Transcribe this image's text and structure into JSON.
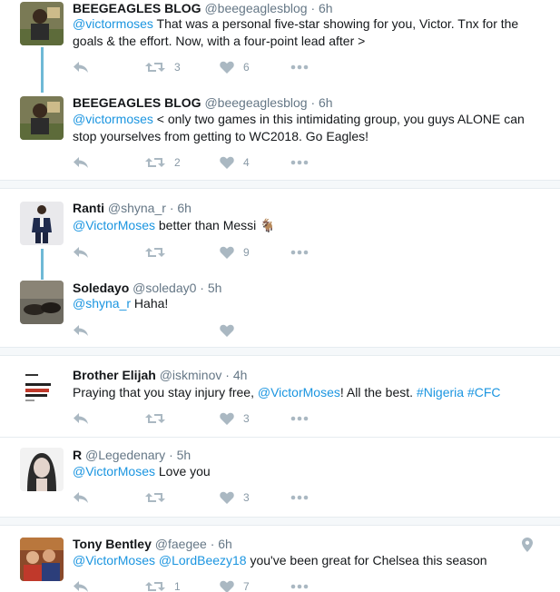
{
  "tweets": [
    {
      "name": "BEEGEAGLES BLOG",
      "handle": "@beegeaglesblog",
      "dot": "·",
      "time": "6h",
      "mention": "@victormoses",
      "text_rest": " That was a personal five-star showing for you, Victor. Tnx for the goals & the effort. Now, with a four-point lead after >",
      "retweets": "3",
      "likes": "6"
    },
    {
      "name": "BEEGEAGLES BLOG",
      "handle": "@beegeaglesblog",
      "dot": "·",
      "time": "6h",
      "mention": "@victormoses",
      "text_rest": " < only two games in this intimidating group, you guys ALONE can stop yourselves from getting to WC2018. Go Eagles!",
      "retweets": "2",
      "likes": "4"
    },
    {
      "name": "Ranti",
      "handle": "@shyna_r",
      "dot": "·",
      "time": "6h",
      "mention": "@VictorMoses",
      "text_rest": " better than Messi 🐐",
      "retweets": "",
      "likes": "9"
    },
    {
      "name": "Soledayo",
      "handle": "@soleday0",
      "dot": "·",
      "time": "5h",
      "mention": "@shyna_r",
      "text_rest": " Haha!",
      "retweets": "",
      "likes": ""
    },
    {
      "name": "Brother Elijah",
      "handle": "@iskminov",
      "dot": "·",
      "time": "4h",
      "text_pre": "Praying that you stay injury free, ",
      "mention": "@VictorMoses",
      "text_mid": "! All the best. ",
      "hashtag1": "#Nigeria",
      "hashtag2": "#CFC",
      "retweets": "",
      "likes": "3"
    },
    {
      "name": "R",
      "handle": "@Legedenary",
      "dot": "·",
      "time": "5h",
      "mention": "@VictorMoses",
      "text_rest": " Love you",
      "retweets": "",
      "likes": "3"
    },
    {
      "name": "Tony Bentley",
      "handle": "@faegee",
      "dot": "·",
      "time": "6h",
      "mention": "@VictorMoses",
      "mention2": "@LordBeezy18",
      "text_rest": " you've been great for Chelsea this season",
      "retweets": "1",
      "likes": "7"
    }
  ],
  "icons": {
    "reply": "reply-icon",
    "retweet": "retweet-icon",
    "like": "heart-icon",
    "more": "more-icon",
    "location": "location-pin-icon"
  },
  "colors": {
    "link": "#1b95e0",
    "thread_line": "#6fb9d6",
    "action_icon": "#aab8c2"
  }
}
